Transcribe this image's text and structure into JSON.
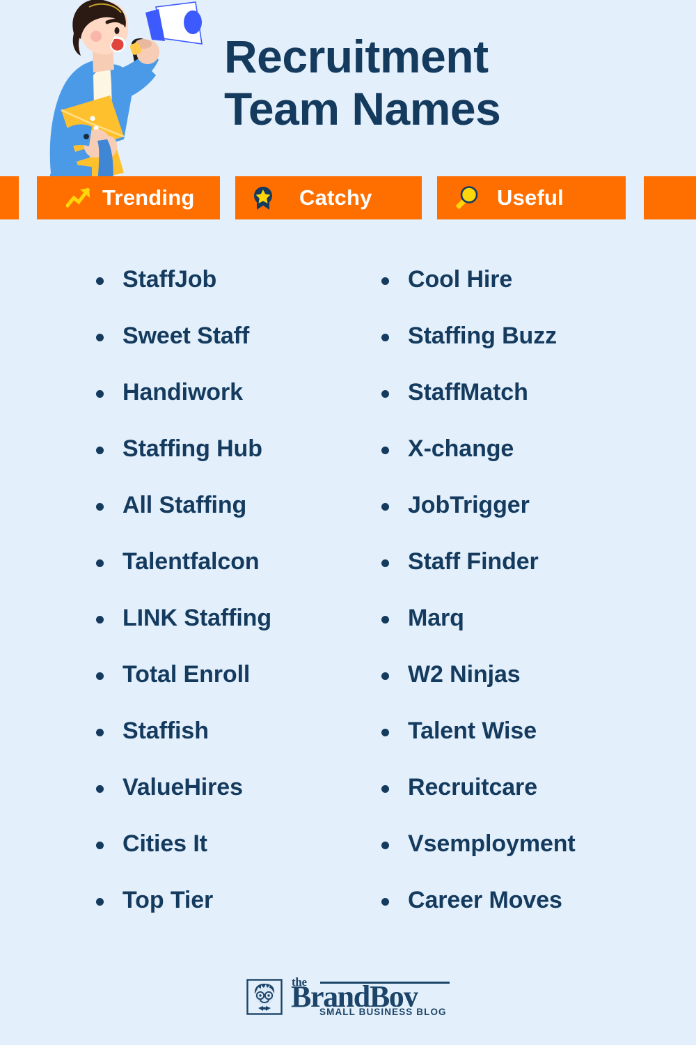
{
  "header": {
    "title": "Recruitment\nTeam Names",
    "illustration_name": "man-with-megaphone-illustration"
  },
  "badges": [
    {
      "label": "Trending",
      "icon": "trending-up-icon"
    },
    {
      "label": "Catchy",
      "icon": "award-star-icon"
    },
    {
      "label": "Useful",
      "icon": "magnifier-icon"
    }
  ],
  "lists": {
    "left_column": [
      "StaffJob",
      "Sweet Staff",
      "Handiwork",
      "Staffing Hub",
      "All Staffing",
      "Talentfalcon",
      "LINK Staffing",
      "Total Enroll",
      "Staffish",
      "ValueHires",
      "Cities It",
      "Top Tier"
    ],
    "right_column": [
      "Cool Hire",
      "Staffing Buzz",
      "StaffMatch",
      "X-change",
      "JobTrigger",
      "Staff Finder",
      "Marq",
      "W2 Ninjas",
      "Talent Wise",
      "Recruitcare",
      "Vsemployment",
      "Career Moves"
    ]
  },
  "footer": {
    "logo_the": "the",
    "logo_main": "BrandBoy",
    "logo_sub": "SMALL BUSINESS BLOG",
    "logo_mark": "boy-face-glasses-icon"
  },
  "colors": {
    "background": "#e3f0fc",
    "accent_orange": "#ff6f00",
    "text_navy": "#143a5e",
    "badge_label": "#ffffff",
    "icon_yellow": "#ffd60a",
    "logo_navy": "#1d4468"
  }
}
